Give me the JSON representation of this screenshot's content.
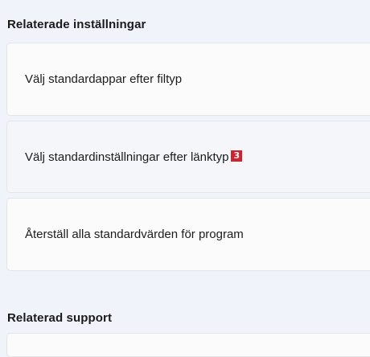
{
  "related_settings": {
    "heading": "Relaterade inställningar",
    "items": [
      {
        "label": "Välj standardappar efter filtyp"
      },
      {
        "label": "Välj standardinställningar efter länktyp",
        "badge": "3"
      },
      {
        "label": "Återställ alla standardvärden för program"
      }
    ]
  },
  "related_support": {
    "heading": "Relaterad support"
  },
  "colors": {
    "page_background": "#f0f3f9",
    "card_background": "#fbfbfc",
    "badge": "#d0222d"
  }
}
